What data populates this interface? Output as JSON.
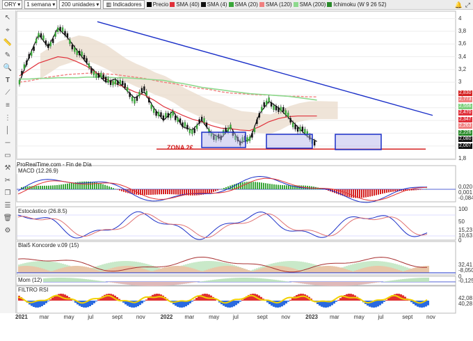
{
  "toolbar": {
    "symbol": "ORY",
    "period": "1 semana",
    "units": "200 unidades",
    "indicators_label": "Indicadores",
    "legend": [
      {
        "label": "Precio",
        "color": "#000000"
      },
      {
        "label": "SMA (40)",
        "color": "#e0303a"
      },
      {
        "label": "SMA (4)",
        "color": "#111111"
      },
      {
        "label": "SMA (20)",
        "color": "#3aa63a"
      },
      {
        "label": "SMA (120)",
        "color": "#f08080"
      },
      {
        "label": "SMA (200)",
        "color": "#8dd98d"
      },
      {
        "label": "Ichimoku (W 9 26 52)",
        "color": "#2a8a2a"
      }
    ]
  },
  "source_label": "ProRealTime.com - Fin de Día",
  "annotation": "ZONA 2€",
  "panels": {
    "price": {
      "ticks": [
        "4",
        "3,8",
        "3,6",
        "3,4",
        "3,2",
        "3",
        "2,8",
        "2,6",
        "2,4",
        "2,2",
        "2",
        "1,8"
      ]
    },
    "macd": {
      "title": "MACD (12.26.9)",
      "ticks": [
        "0,020",
        "0,001",
        "-0,084"
      ]
    },
    "stoch": {
      "title": "Estocástico (26.8.5)",
      "ticks": [
        "100",
        "50",
        "15,23",
        "10,63",
        "0"
      ]
    },
    "koncorde": {
      "title": "Blai5 Koncorde v.09 (15)",
      "ticks": [
        "32,41",
        "-8,050"
      ]
    },
    "mom": {
      "title": "Mom (12)",
      "ticks": [
        "0",
        "-0,125"
      ]
    },
    "rsi": {
      "title": "FILTRO RSI",
      "ticks": [
        "42,08",
        "40,28"
      ]
    }
  },
  "price_tags": [
    {
      "text": "2,830",
      "color": "#d42020"
    },
    {
      "text": "2,773",
      "color": "#f08080"
    },
    {
      "text": "2,556",
      "color": "#7ccf7c"
    },
    {
      "text": "2,470",
      "color": "#e0303a"
    },
    {
      "text": "2,347",
      "color": "#e0303a"
    },
    {
      "text": "2,263",
      "color": "#f08080"
    },
    {
      "text": "2,226",
      "color": "#2a8a2a"
    },
    {
      "text": "2,080",
      "color": "#111111"
    },
    {
      "text": "2,007",
      "color": "#111111"
    }
  ],
  "xaxis": [
    "2021",
    "mar",
    "may",
    "jul",
    "sept",
    "nov",
    "2022",
    "mar",
    "may",
    "jul",
    "sept",
    "nov",
    "2023",
    "mar",
    "may",
    "jul",
    "sept",
    "nov"
  ],
  "chart_data": [
    {
      "type": "line",
      "title": "ORY 1 semana",
      "ylim": [
        1.8,
        4.05
      ],
      "x_labels": [
        "2021",
        "mar",
        "may",
        "jul",
        "sept",
        "nov",
        "2022",
        "mar",
        "may",
        "jul",
        "sept",
        "nov",
        "2023",
        "mar",
        "may",
        "jul",
        "sept",
        "nov"
      ],
      "series": [
        {
          "name": "Precio",
          "values": [
            3.0,
            3.4,
            3.75,
            3.55,
            3.85,
            3.7,
            3.5,
            3.3,
            3.15,
            3.0,
            3.05,
            2.9,
            2.75,
            2.85,
            2.6,
            2.4,
            2.55,
            2.3,
            2.25,
            2.4,
            2.2,
            2.12,
            2.3,
            2.05,
            2.1,
            2.5,
            2.7,
            2.6,
            2.45,
            2.3,
            2.15,
            2.07
          ]
        },
        {
          "name": "SMA (40)",
          "values": [
            3.1,
            3.2,
            3.3,
            3.35,
            3.4,
            3.38,
            3.32,
            3.25,
            3.15,
            3.05,
            2.98,
            2.92,
            2.85,
            2.8,
            2.72,
            2.62,
            2.55,
            2.48,
            2.42,
            2.38,
            2.32,
            2.28,
            2.27,
            2.25,
            2.24,
            2.3,
            2.38,
            2.43,
            2.46,
            2.47,
            2.47,
            2.47
          ]
        },
        {
          "name": "SMA (120)",
          "values": [
            3.0,
            3.02,
            3.05,
            3.08,
            3.1,
            3.12,
            3.13,
            3.14,
            3.14,
            3.13,
            3.12,
            3.1,
            3.08,
            3.06,
            3.03,
            3.0,
            2.98,
            2.95,
            2.92,
            2.9,
            2.88,
            2.85,
            2.83,
            2.82,
            2.81,
            2.8,
            2.8,
            2.79,
            2.78,
            2.78,
            2.77,
            2.77
          ]
        },
        {
          "name": "SMA (200)",
          "values": [
            3.05,
            3.05,
            3.06,
            3.06,
            3.07,
            3.07,
            3.07,
            3.08,
            3.08,
            3.08,
            3.07,
            3.07,
            3.06,
            3.05,
            3.04,
            3.03,
            3.0,
            2.98,
            2.95,
            2.92,
            2.9,
            2.88,
            2.86,
            2.84,
            2.82,
            2.81,
            2.8,
            2.79,
            2.78,
            2.76,
            2.74,
            2.72
          ]
        }
      ],
      "horizontal_lines": [
        {
          "label": "ZONA 2€",
          "value": 1.95
        }
      ]
    }
  ]
}
